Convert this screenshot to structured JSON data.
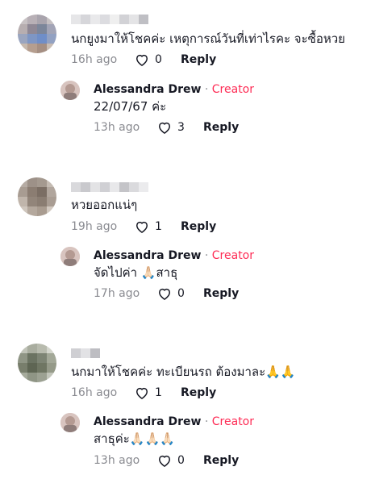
{
  "comments": [
    {
      "text": "นกยูงมาให้โชคค่ะ เหตุการณ์วันที่เท่าไรคะ จะซื้อหวย",
      "time": "16h ago",
      "likes": "0",
      "reply_label": "Reply",
      "reply": {
        "author": "Alessandra Drew",
        "separator": "·",
        "badge": "Creator",
        "text": "22/07/67 ค่ะ",
        "time": "13h ago",
        "likes": "3",
        "reply_label": "Reply"
      }
    },
    {
      "text": "หวยออกแน่ๆ",
      "time": "19h ago",
      "likes": "1",
      "reply_label": "Reply",
      "reply": {
        "author": "Alessandra Drew",
        "separator": "·",
        "badge": "Creator",
        "text": "จัดไปค่า 🙏🏻สาธุ",
        "time": "17h ago",
        "likes": "0",
        "reply_label": "Reply"
      }
    },
    {
      "text": "นกมาให้โชคค่ะ ทะเบียนรถ ต้องมาละ🙏🙏",
      "time": "16h ago",
      "likes": "1",
      "reply_label": "Reply",
      "reply": {
        "author": "Alessandra Drew",
        "separator": "·",
        "badge": "Creator",
        "text": "สาธุค่ะ🙏🏻🙏🏻🙏🏻",
        "time": "13h ago",
        "likes": "0",
        "reply_label": "Reply"
      }
    }
  ],
  "colors": {
    "creator_badge": "#fe2c55",
    "meta_text": "#8a8b91",
    "primary_text": "#161823"
  },
  "icons": {
    "like": "heart-outline-icon"
  }
}
